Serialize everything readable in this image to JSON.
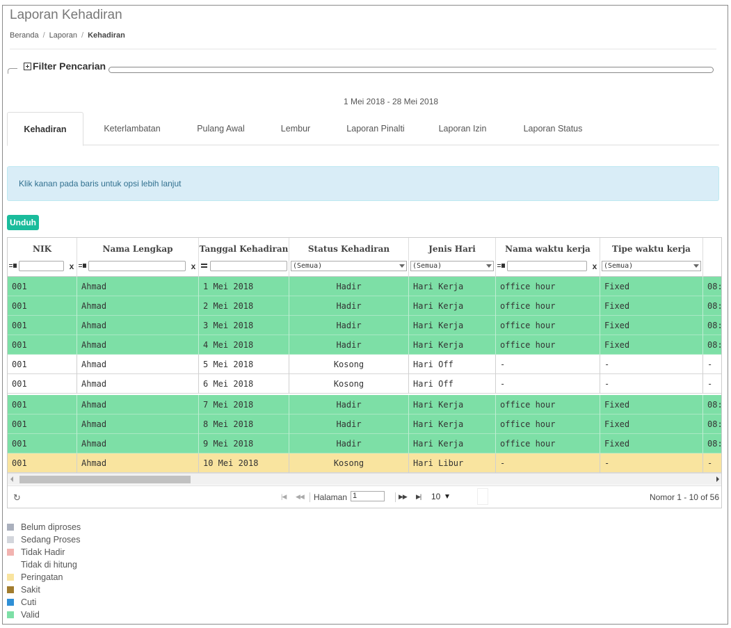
{
  "page": {
    "title": "Laporan Kehadiran",
    "breadcrumb": [
      "Beranda",
      "Laporan",
      "Kehadiran"
    ],
    "filter_title": "Filter Pencarian",
    "date_range": "1 Mei 2018 - 28 Mei 2018"
  },
  "tabs": [
    "Kehadiran",
    "Keterlambatan",
    "Pulang Awal",
    "Lembur",
    "Laporan Pinalti",
    "Laporan Izin",
    "Laporan Status"
  ],
  "active_tab": "Kehadiran",
  "info": "Klik kanan pada baris untuk opsi lebih lanjut",
  "download_label": "Unduh",
  "grid": {
    "columns": [
      "NIK",
      "Nama Lengkap",
      "Tanggal Kehadiran",
      "Status Kehadiran",
      "Jenis Hari",
      "Nama waktu kerja",
      "Tipe waktu kerja"
    ],
    "select_default": "(Semua)",
    "clear_symbol": "x",
    "rows": [
      {
        "cells": [
          "001",
          "Ahmad",
          "1 Mei 2018",
          "Hadir",
          "Hari Kerja",
          "office hour",
          "Fixed",
          "08:"
        ],
        "status": "green"
      },
      {
        "cells": [
          "001",
          "Ahmad",
          "2 Mei 2018",
          "Hadir",
          "Hari Kerja",
          "office hour",
          "Fixed",
          "08:"
        ],
        "status": "green"
      },
      {
        "cells": [
          "001",
          "Ahmad",
          "3 Mei 2018",
          "Hadir",
          "Hari Kerja",
          "office hour",
          "Fixed",
          "08:"
        ],
        "status": "green"
      },
      {
        "cells": [
          "001",
          "Ahmad",
          "4 Mei 2018",
          "Hadir",
          "Hari Kerja",
          "office hour",
          "Fixed",
          "08:"
        ],
        "status": "green"
      },
      {
        "cells": [
          "001",
          "Ahmad",
          "5 Mei 2018",
          "Kosong",
          "Hari Off",
          "-",
          "-",
          "-"
        ],
        "status": "white"
      },
      {
        "cells": [
          "001",
          "Ahmad",
          "6 Mei 2018",
          "Kosong",
          "Hari Off",
          "-",
          "-",
          "-"
        ],
        "status": "white"
      },
      {
        "cells": [
          "001",
          "Ahmad",
          "7 Mei 2018",
          "Hadir",
          "Hari Kerja",
          "office hour",
          "Fixed",
          "08:"
        ],
        "status": "green"
      },
      {
        "cells": [
          "001",
          "Ahmad",
          "8 Mei 2018",
          "Hadir",
          "Hari Kerja",
          "office hour",
          "Fixed",
          "08:"
        ],
        "status": "green"
      },
      {
        "cells": [
          "001",
          "Ahmad",
          "9 Mei 2018",
          "Hadir",
          "Hari Kerja",
          "office hour",
          "Fixed",
          "08:"
        ],
        "status": "green"
      },
      {
        "cells": [
          "001",
          "Ahmad",
          "10 Mei 2018",
          "Kosong",
          "Hari Libur",
          "-",
          "-",
          "-"
        ],
        "status": "yellow"
      }
    ]
  },
  "pager": {
    "page_label": "Halaman",
    "page_value": "1",
    "rows_per_page": "10",
    "record_info": "Nomor 1 - 10 of 56"
  },
  "legend": [
    {
      "label": "Belum diproses",
      "color": "#aab0bd"
    },
    {
      "label": "Sedang Proses",
      "color": "#d3d6dc"
    },
    {
      "label": "Tidak Hadir",
      "color": "#f2b3b0"
    },
    {
      "label": "Tidak di hitung",
      "color": "#ffffff"
    },
    {
      "label": "Peringatan",
      "color": "#f9e49f"
    },
    {
      "label": "Sakit",
      "color": "#a17c2e"
    },
    {
      "label": "Cuti",
      "color": "#2f8fd6"
    },
    {
      "label": "Valid",
      "color": "#7ddfa6"
    }
  ],
  "colors": {
    "green_row": "#7ddfa6",
    "yellow_row": "#f9e49f",
    "accent": "#1abc9c",
    "info_bg": "#d9edf7"
  },
  "icons": {
    "expand": "plus-square-icon",
    "refresh": "refresh-icon",
    "first": "first-page-icon",
    "prev": "prev-page-icon",
    "next": "next-page-icon",
    "last": "last-page-icon"
  }
}
